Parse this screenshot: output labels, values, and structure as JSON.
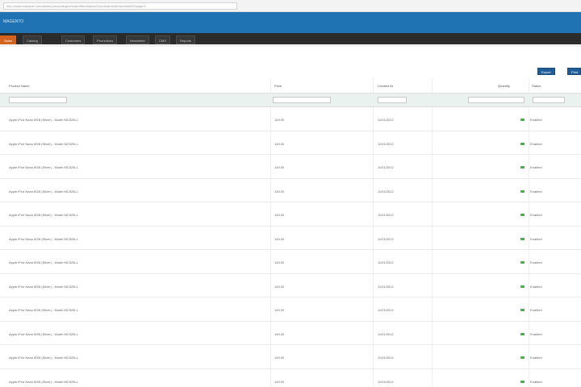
{
  "browser": {
    "address": "http://www.example.com/admin/products/grid/index/filter/status/1/sort/name/dir/asc/limit/20/page/1"
  },
  "header": {
    "brand": "MAGENTO"
  },
  "nav": {
    "items": [
      {
        "label": "Sales",
        "active": true
      },
      {
        "label": "Catalog",
        "active": false
      },
      {
        "label": "Customers",
        "active": false
      },
      {
        "label": "Promotions",
        "active": false
      },
      {
        "label": "Newsletter",
        "active": false
      },
      {
        "label": "CMS",
        "active": false
      },
      {
        "label": "Reports",
        "active": false
      }
    ]
  },
  "toolbar": {
    "export_label": "Export",
    "print_label": "Print"
  },
  "grid": {
    "columns": [
      "Product Name",
      "Price",
      "Created At",
      "Quantity",
      "Status"
    ],
    "rows": [
      {
        "name": "Apple iPod Nano 8GB (Silver) - Model MC525LL",
        "price": "149.00",
        "date": "11/01/2012",
        "status": "Enabled"
      },
      {
        "name": "Apple iPod Nano 8GB (Silver) - Model MC525LL",
        "price": "149.00",
        "date": "11/01/2012",
        "status": "Enabled"
      },
      {
        "name": "Apple iPod Nano 8GB (Silver) - Model MC525LL",
        "price": "149.00",
        "date": "11/01/2012",
        "status": "Enabled"
      },
      {
        "name": "Apple iPod Nano 8GB (Silver) - Model MC525LL",
        "price": "149.00",
        "date": "11/01/2012",
        "status": "Enabled"
      },
      {
        "name": "Apple iPod Nano 8GB (Silver) - Model MC525LL",
        "price": "149.00",
        "date": "11/01/2012",
        "status": "Enabled"
      },
      {
        "name": "Apple iPod Nano 8GB (Silver) - Model MC525LL",
        "price": "149.00",
        "date": "11/01/2012",
        "status": "Enabled"
      },
      {
        "name": "Apple iPod Nano 8GB (Silver) - Model MC525LL",
        "price": "149.00",
        "date": "11/01/2012",
        "status": "Enabled"
      },
      {
        "name": "Apple iPod Nano 8GB (Silver) - Model MC525LL",
        "price": "149.00",
        "date": "11/01/2012",
        "status": "Enabled"
      },
      {
        "name": "Apple iPod Nano 8GB (Silver) - Model MC525LL",
        "price": "149.00",
        "date": "11/01/2012",
        "status": "Enabled"
      },
      {
        "name": "Apple iPod Nano 8GB (Silver) - Model MC525LL",
        "price": "149.00",
        "date": "11/01/2012",
        "status": "Enabled"
      },
      {
        "name": "Apple iPod Nano 8GB (Silver) - Model MC525LL",
        "price": "149.00",
        "date": "11/01/2012",
        "status": "Enabled"
      },
      {
        "name": "Apple iPod Nano 8GB (Silver) - Model MC525LL",
        "price": "149.00",
        "date": "11/01/2012",
        "status": "Enabled"
      }
    ]
  },
  "colors": {
    "header": "#1f73b3",
    "nav": "#2b2b2b",
    "nav_active": "#d2631f",
    "button": "#1f5d96",
    "status_ok": "#4caf50"
  }
}
